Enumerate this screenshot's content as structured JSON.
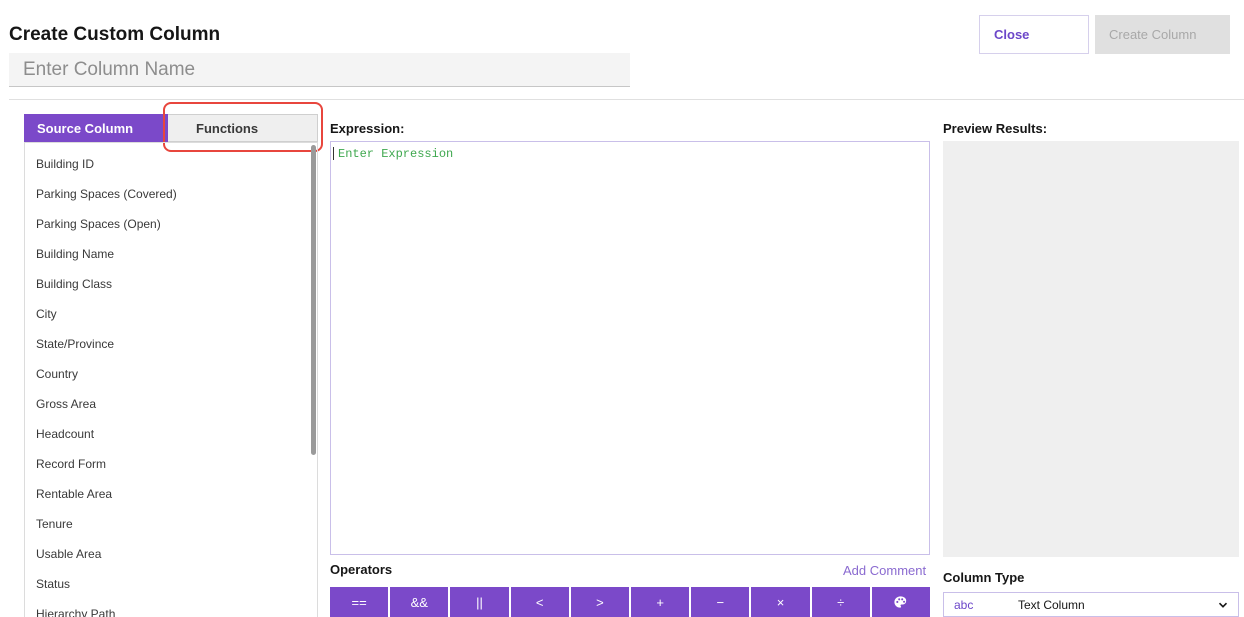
{
  "header": {
    "title": "Create Custom Column",
    "name_placeholder": "Enter Column Name",
    "close_label": "Close",
    "create_label": "Create Column"
  },
  "left": {
    "tabs": [
      {
        "label": "Source Column",
        "active": true
      },
      {
        "label": "Functions",
        "active": false
      }
    ],
    "columns": [
      "Building ID",
      "Parking Spaces (Covered)",
      "Parking Spaces (Open)",
      "Building Name",
      "Building Class",
      "City",
      "State/Province",
      "Country",
      "Gross Area",
      "Headcount",
      "Record Form",
      "Rentable Area",
      "Tenure",
      "Usable Area",
      "Status",
      "Hierarchy Path"
    ]
  },
  "expression": {
    "label": "Expression:",
    "placeholder": "Enter Expression"
  },
  "operators": {
    "label": "Operators",
    "add_comment": "Add Comment",
    "buttons": [
      "==",
      "&&",
      "||",
      "<",
      ">",
      "+",
      "−",
      "×",
      "÷"
    ],
    "palette_icon": "palette-icon"
  },
  "preview": {
    "label": "Preview Results:"
  },
  "column_type": {
    "label": "Column Type",
    "prefix": "abc",
    "value": "Text Column"
  },
  "colors": {
    "accent": "#7b49c9",
    "highlight": "#e8463d",
    "expression_text": "#3fa84f"
  }
}
